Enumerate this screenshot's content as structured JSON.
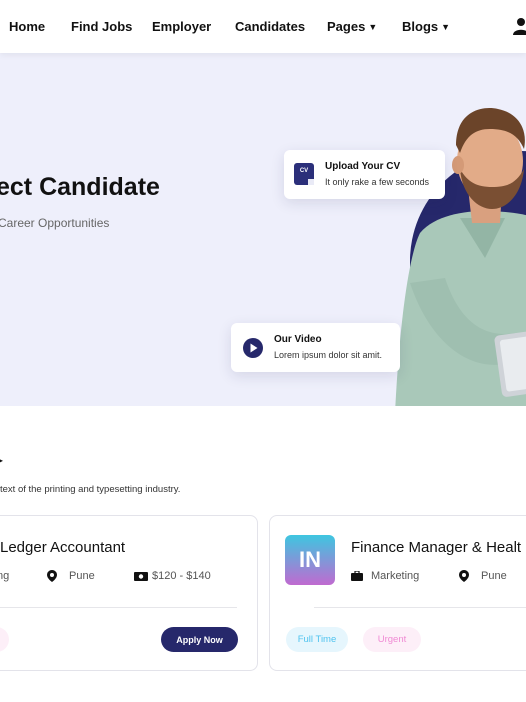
{
  "nav": {
    "items": [
      "Home",
      "Find Jobs",
      "Employer",
      "Candidates",
      "Pages",
      "Blogs"
    ],
    "dropdown_chevron": "⌄"
  },
  "hero": {
    "title": "ect Candidate",
    "subtitle": "Career Opportunities",
    "upload_card": {
      "badge": "CV",
      "title": "Upload Your CV",
      "desc": "It only rake a few seconds"
    },
    "video_card": {
      "title": "Our Video",
      "desc": "Lorem ipsum dolor sit amit."
    }
  },
  "section": {
    "heading_fragment": "▸",
    "subtitle": "text of the printing and typesetting industry."
  },
  "jobs": [
    {
      "title": "Ledger Accountant",
      "category": "ng",
      "location": "Pune",
      "salary": "$120 - $140",
      "apply_label": "Apply Now"
    },
    {
      "logo": "IN",
      "title": "Finance Manager & Healt",
      "category": "Marketing",
      "location": "Pune",
      "type": "Full Time",
      "urgency": "Urgent"
    }
  ],
  "colors": {
    "brand_navy": "#26286b",
    "hero_bg": "#eeeffb",
    "fulltime_bg": "#e6f6fd",
    "fulltime_text": "#4fc3ef",
    "urgent_bg": "#fdeff8",
    "urgent_text": "#f08ad4"
  }
}
